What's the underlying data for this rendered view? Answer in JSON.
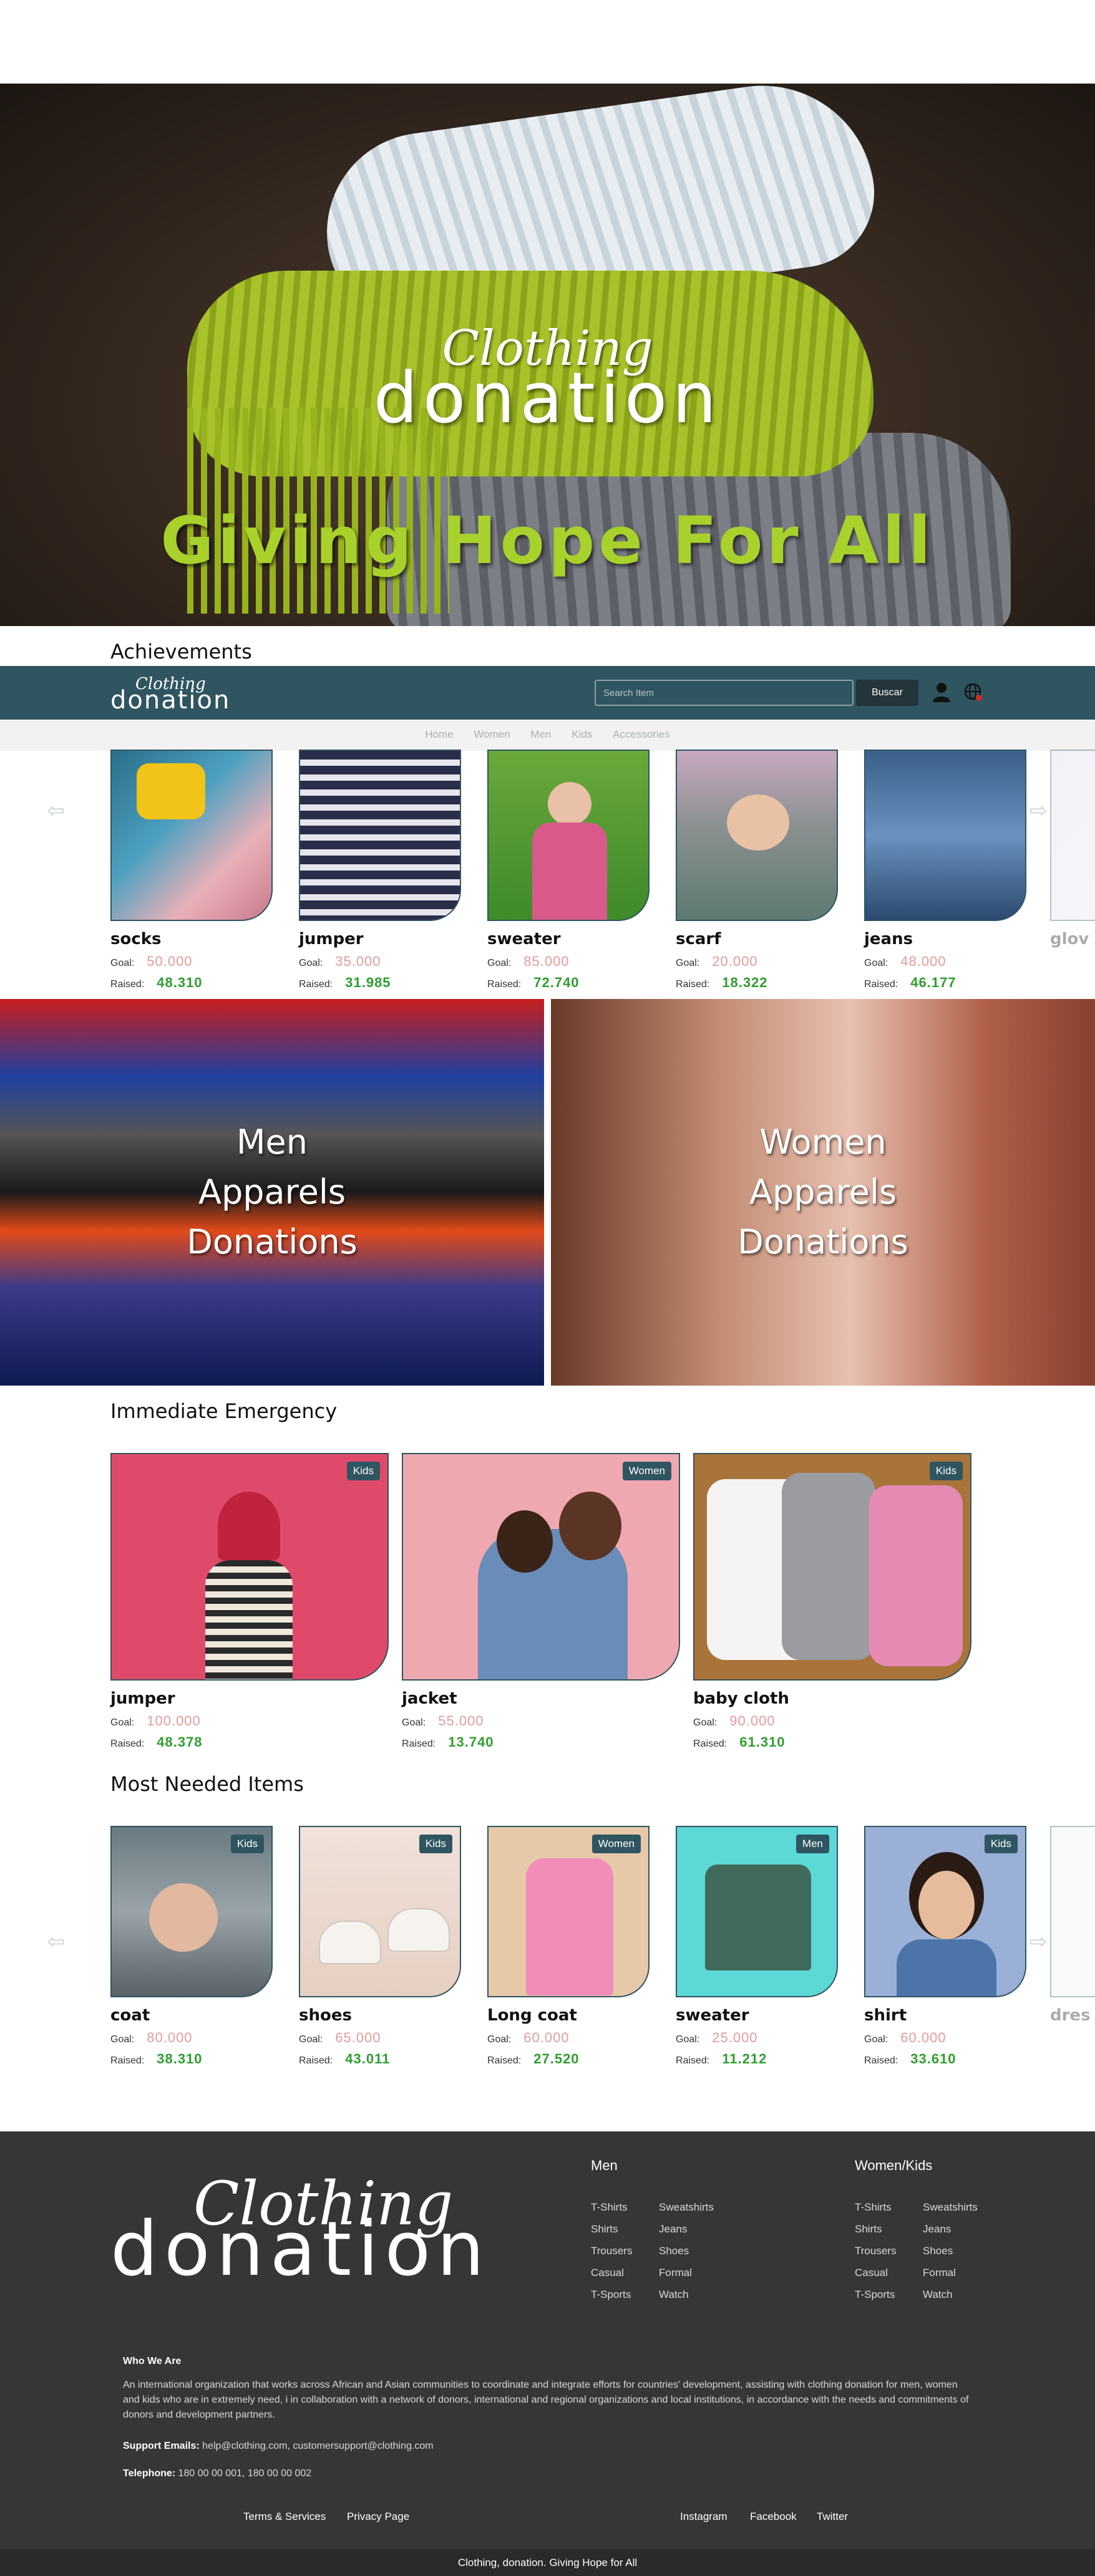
{
  "hero": {
    "logo_script": "Clothing",
    "logo_main": "donation",
    "tagline": "Giving Hope For All"
  },
  "achievements": {
    "title": "Achievements",
    "items": [
      {
        "name": "socks",
        "goal": "50.000",
        "raised": "48.310"
      },
      {
        "name": "jumper",
        "goal": "35.000",
        "raised": "31.985"
      },
      {
        "name": "sweater",
        "goal": "85.000",
        "raised": "72.740"
      },
      {
        "name": "scarf",
        "goal": "20.000",
        "raised": "18.322"
      },
      {
        "name": "jeans",
        "goal": "48.000",
        "raised": "46.177"
      },
      {
        "name": "glov",
        "goal": "",
        "raised": ""
      }
    ]
  },
  "labels": {
    "goal": "Goal:",
    "raised": "Raised:"
  },
  "navbar": {
    "logo_script": "Clothing",
    "logo_main": "donation",
    "search_placeholder": "Search Item",
    "search_button": "Buscar"
  },
  "subnav": [
    "Home",
    "Women",
    "Men",
    "Kids",
    "Accessories"
  ],
  "banners": {
    "men": [
      "Men",
      "Apparels",
      "Donations"
    ],
    "women": [
      "Women",
      "Apparels",
      "Donations"
    ]
  },
  "emergency": {
    "title": "Immediate Emergency",
    "items": [
      {
        "name": "jumper",
        "goal": "100.000",
        "raised": "48.378",
        "tag": "Kids"
      },
      {
        "name": "jacket",
        "goal": "55.000",
        "raised": "13.740",
        "tag": "Women"
      },
      {
        "name": "baby cloth",
        "goal": "90.000",
        "raised": "61.310",
        "tag": "Kids"
      }
    ]
  },
  "needed": {
    "title": "Most Needed Items",
    "items": [
      {
        "name": "coat",
        "goal": "80.000",
        "raised": "38.310",
        "tag": "Kids"
      },
      {
        "name": "shoes",
        "goal": "65.000",
        "raised": "43.011",
        "tag": "Kids"
      },
      {
        "name": "Long coat",
        "goal": "60.000",
        "raised": "27.520",
        "tag": "Women"
      },
      {
        "name": "sweater",
        "goal": "25.000",
        "raised": "11.212",
        "tag": "Men"
      },
      {
        "name": "shirt",
        "goal": "60.000",
        "raised": "33.610",
        "tag": "Kids"
      },
      {
        "name": "dres",
        "goal": "",
        "raised": ""
      }
    ]
  },
  "footer": {
    "logo_script": "Clothing",
    "logo_main": "donation",
    "men_title": "Men",
    "men_col1": [
      "T-Shirts",
      "Shirts",
      "Trousers",
      "Casual",
      "T-Sports"
    ],
    "men_col2": [
      "Sweatshirts",
      "Jeans",
      "Shoes",
      "Formal",
      "Watch"
    ],
    "wk_title": "Women/Kids",
    "wk_col1": [
      "T-Shirts",
      "Shirts",
      "Trousers",
      "Casual",
      "T-Sports"
    ],
    "wk_col2": [
      "Sweatshirts",
      "Jeans",
      "Shoes",
      "Formal",
      "Watch"
    ],
    "who_title": "Who We Are",
    "who_text": "An international organization that works across African and Asian communities to coordinate and integrate efforts for countries' development, assisting with clothing donation for men, women and kids who are in extremely need, i in collaboration with a network of donors, international and regional organizations and local institutions, in accordance with the needs and commitments of donors and development partners.",
    "support_label": "Support Emails:",
    "support_value": "help@clothing.com, customersupport@clothing.com",
    "phone_label": "Telephone:",
    "phone_value": "180 00 00 001, 180 00 00 002",
    "terms": "Terms & Services",
    "privacy": "Privacy Page",
    "instagram": "Instagram",
    "facebook": "Facebook",
    "twitter": "Twitter",
    "copyright": "Clothing, donation. Giving Hope for All"
  },
  "colors": {
    "brand": "#2f5560",
    "goal": "#e59a9a",
    "raised": "#2f9e2f",
    "tagline": "#a9d12c",
    "footer": "#363636"
  },
  "icons": {
    "user": "user-icon",
    "globe": "globe-icon",
    "prev": "arrow-left-icon",
    "next": "arrow-right-icon"
  }
}
